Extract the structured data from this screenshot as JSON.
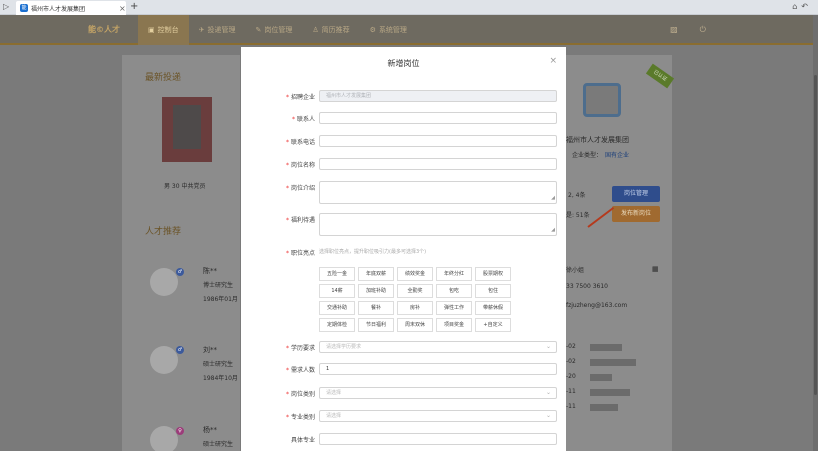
{
  "browser": {
    "tab_title": "福州市人才发展集团",
    "close": "×",
    "new_tab": "+",
    "nav": "▷"
  },
  "header": {
    "logo": "能©人才",
    "menu": [
      {
        "label": "控制台",
        "icon": "dashboard-icon",
        "glyph": "▣"
      },
      {
        "label": "投递管理",
        "icon": "send-icon",
        "glyph": "✈"
      },
      {
        "label": "岗位管理",
        "icon": "edit-icon",
        "glyph": "✎"
      },
      {
        "label": "简历推荐",
        "icon": "user-icon",
        "glyph": "♙"
      },
      {
        "label": "系统管理",
        "icon": "gear-icon",
        "glyph": "⚙"
      }
    ]
  },
  "background": {
    "latest_title": "最新投递",
    "candidate_caption": "男 30 中共党员",
    "talent_title": "人才推荐",
    "talents": [
      {
        "name": "陈**",
        "degree": "博士研究生",
        "birth": "1986年01月"
      },
      {
        "name": "刘**",
        "degree": "硕士研究生",
        "birth": "1984年10月"
      },
      {
        "name": "杨**",
        "degree": "硕士研究生",
        "birth": ""
      }
    ],
    "company_name": "福州市人才发展集团",
    "company_type_label": "企业类型：",
    "company_type": "国有企业",
    "ribbon": "已认证",
    "stat1": "2, 4条",
    "stat2": "是: 51条",
    "btn_manage": "岗位管理",
    "btn_publish": "发布新岗位",
    "contact_name": "徐小姐",
    "phone": "33 7500 3610",
    "email": "fzjuzheng@163.com",
    "dates": [
      "-02",
      "-02",
      "-20",
      "-11",
      "-11"
    ]
  },
  "modal": {
    "title": "新增岗位",
    "close": "×",
    "fields": {
      "company": {
        "label": "招聘企业",
        "value": "福州市人才发展集团"
      },
      "contact": {
        "label": "联系人",
        "value": ""
      },
      "phone": {
        "label": "联系电话",
        "value": ""
      },
      "post_name": {
        "label": "岗位名称",
        "value": ""
      },
      "post_intro": {
        "label": "岗位介绍",
        "value": ""
      },
      "welfare": {
        "label": "福利待遇",
        "value": ""
      },
      "highlights": {
        "label": "职位亮点",
        "hint": "选择职位亮点，提升职位吸引力(最多可选择3个)"
      },
      "education": {
        "label": "学历要求",
        "placeholder": "请选择学历要求"
      },
      "headcount": {
        "label": "需求人数",
        "value": "1"
      },
      "post_type": {
        "label": "岗位类别",
        "placeholder": "请选择"
      },
      "major_type": {
        "label": "专业类别",
        "placeholder": "请选择"
      },
      "major": {
        "label": "具体专业",
        "value": ""
      }
    },
    "tags": [
      "五险一金",
      "年底双薪",
      "绩效奖金",
      "年终分红",
      "股票期权",
      "14薪",
      "加班补助",
      "全勤奖",
      "包吃",
      "包住",
      "交通补助",
      "餐补",
      "房补",
      "弹性工作",
      "带薪休假",
      "定期体检",
      "节日福利",
      "周末双休",
      "项目奖金",
      "+自定义"
    ]
  }
}
